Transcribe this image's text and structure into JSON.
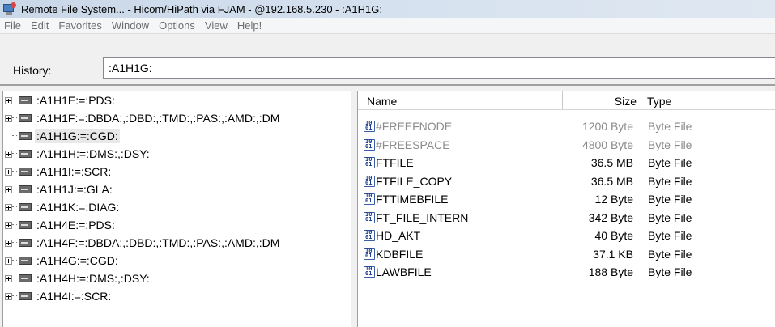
{
  "window": {
    "title": "Remote File System... - Hicom/HiPath via FJAM - @192.168.5.230 - :A1H1G:"
  },
  "menu": [
    "File",
    "Edit",
    "Favorites",
    "Window",
    "Options",
    "View",
    "Help!"
  ],
  "history": {
    "label": "History:",
    "value": ":A1H1G:"
  },
  "tree": [
    {
      "label": ":A1H1E:=:PDS:",
      "expandable": true
    },
    {
      "label": ":A1H1F:=:DBDA:,:DBD:,:TMD:,:PAS:,:AMD:,:DM",
      "expandable": true
    },
    {
      "label": ":A1H1G:=:CGD:",
      "expandable": false,
      "selected": true
    },
    {
      "label": ":A1H1H:=:DMS:,:DSY:",
      "expandable": true
    },
    {
      "label": ":A1H1I:=:SCR:",
      "expandable": true
    },
    {
      "label": ":A1H1J:=:GLA:",
      "expandable": true
    },
    {
      "label": ":A1H1K:=:DIAG:",
      "expandable": true
    },
    {
      "label": ":A1H4E:=:PDS:",
      "expandable": true
    },
    {
      "label": ":A1H4F:=:DBDA:,:DBD:,:TMD:,:PAS:,:AMD:,:DM",
      "expandable": true
    },
    {
      "label": ":A1H4G:=:CGD:",
      "expandable": true
    },
    {
      "label": ":A1H4H:=:DMS:,:DSY:",
      "expandable": true
    },
    {
      "label": ":A1H4I:=:SCR:",
      "expandable": true
    }
  ],
  "list": {
    "columns": {
      "name": "Name",
      "size": "Size",
      "type": "Type"
    },
    "rows": [
      {
        "name": "#FREEFNODE",
        "size": "1200 Byte",
        "type": "Byte File",
        "dim": true
      },
      {
        "name": "#FREESPACE",
        "size": "4800 Byte",
        "type": "Byte File",
        "dim": true
      },
      {
        "name": "FTFILE",
        "size": "36.5 MB",
        "type": "Byte File",
        "dim": false
      },
      {
        "name": "FTFILE_COPY",
        "size": "36.5 MB",
        "type": "Byte File",
        "dim": false
      },
      {
        "name": "FTTIMEBFILE",
        "size": "12 Byte",
        "type": "Byte File",
        "dim": false
      },
      {
        "name": "FT_FILE_INTERN",
        "size": "342 Byte",
        "type": "Byte File",
        "dim": false
      },
      {
        "name": "HD_AKT",
        "size": "40 Byte",
        "type": "Byte File",
        "dim": false
      },
      {
        "name": "KDBFILE",
        "size": "37.1 KB",
        "type": "Byte File",
        "dim": false
      },
      {
        "name": "LAWBFILE",
        "size": "188 Byte",
        "type": "Byte File",
        "dim": false
      }
    ]
  }
}
